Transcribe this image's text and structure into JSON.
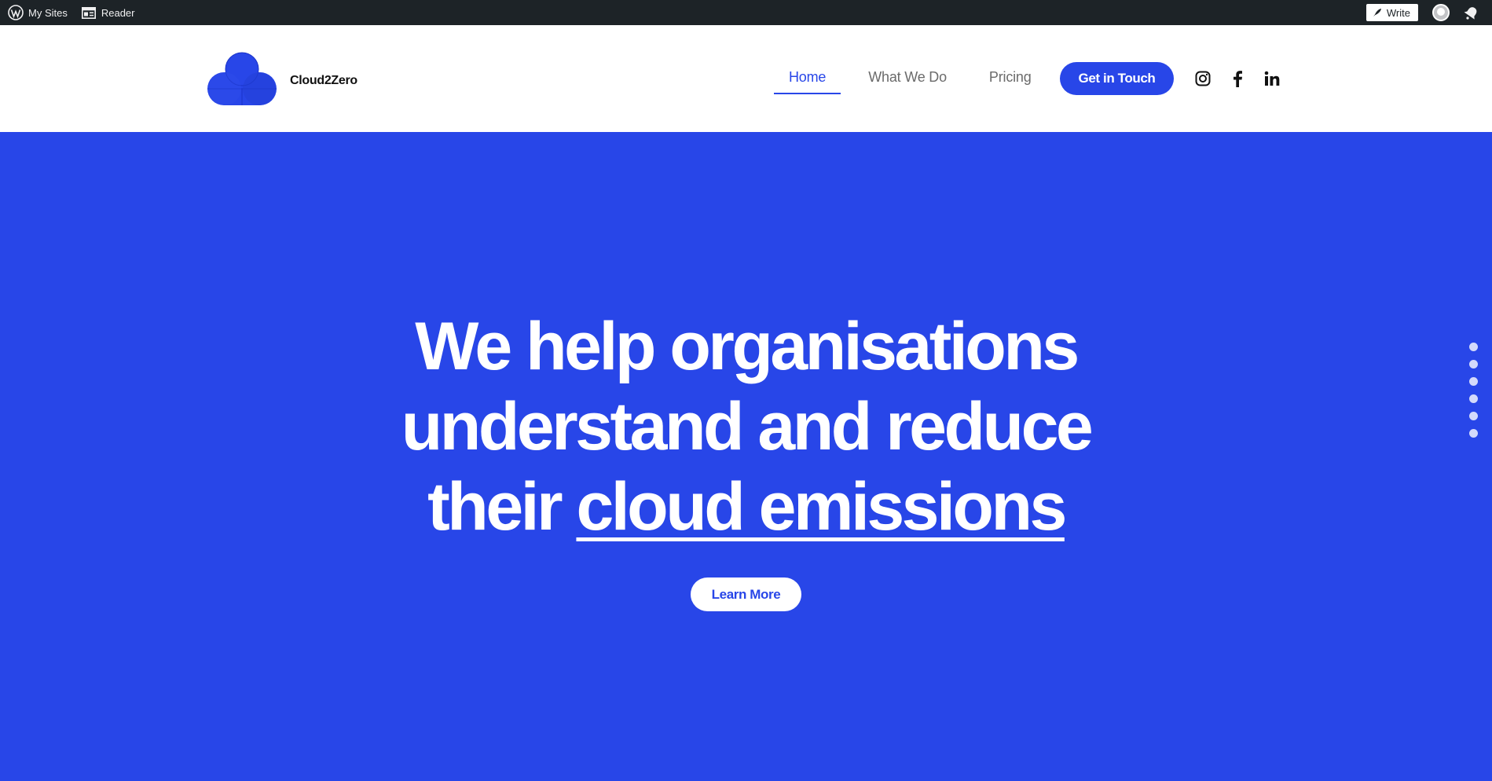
{
  "adminbar": {
    "wp_icon": "wordpress-logo-icon",
    "my_sites": "My Sites",
    "reader_icon": "reader-icon",
    "reader": "Reader",
    "write": "Write",
    "avatar": "user-avatar",
    "notifications_icon": "bell-icon",
    "bg_color": "#1d2327"
  },
  "header": {
    "logo_text": "Cloud2Zero",
    "nav": [
      {
        "label": "Home",
        "active": true
      },
      {
        "label": "What We Do",
        "active": false
      },
      {
        "label": "Pricing",
        "active": false
      }
    ],
    "cta": "Get in Touch",
    "social": [
      "instagram-icon",
      "facebook-icon",
      "linkedin-icon"
    ]
  },
  "hero": {
    "line1": "We help organisations",
    "line2": "understand and reduce",
    "line3_plain": "their",
    "line3_underlined": "cloud emissions",
    "button": "Learn More",
    "bg_color": "#2846e8",
    "section_dots": 6
  }
}
